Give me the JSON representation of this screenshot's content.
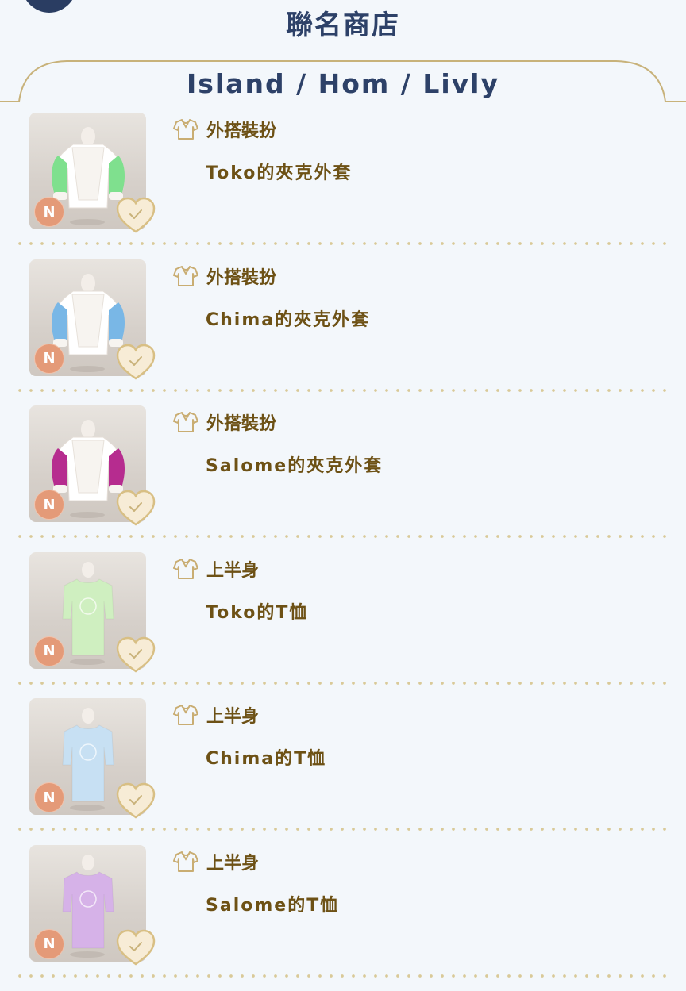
{
  "header": {
    "title": "聯名商店",
    "subtitle": "Island / Hom / Livly"
  },
  "items": [
    {
      "category": "外搭裝扮",
      "name": "Toko的夾克外套",
      "rarity": "N",
      "garment_color": "#7fe08e",
      "garment": "jacket"
    },
    {
      "category": "外搭裝扮",
      "name": "Chima的夾克外套",
      "rarity": "N",
      "garment_color": "#79b7e6",
      "garment": "jacket"
    },
    {
      "category": "外搭裝扮",
      "name": "Salome的夾克外套",
      "rarity": "N",
      "garment_color": "#b62c8f",
      "garment": "jacket"
    },
    {
      "category": "上半身",
      "name": "Toko的T恤",
      "rarity": "N",
      "garment_color": "#cfefc0",
      "garment": "tshirt"
    },
    {
      "category": "上半身",
      "name": "Chima的T恤",
      "rarity": "N",
      "garment_color": "#c7e0f3",
      "garment": "tshirt"
    },
    {
      "category": "上半身",
      "name": "Salome的T恤",
      "rarity": "N",
      "garment_color": "#d6b2e8",
      "garment": "tshirt"
    }
  ],
  "icons": {
    "category_icon": "shirt-outline-icon",
    "favorite_icon": "heart-check-icon"
  },
  "colors": {
    "title": "#2d4168",
    "item_text": "#6d5115",
    "gold_line": "#c8b27a",
    "rarity_badge": "#e49a78"
  }
}
